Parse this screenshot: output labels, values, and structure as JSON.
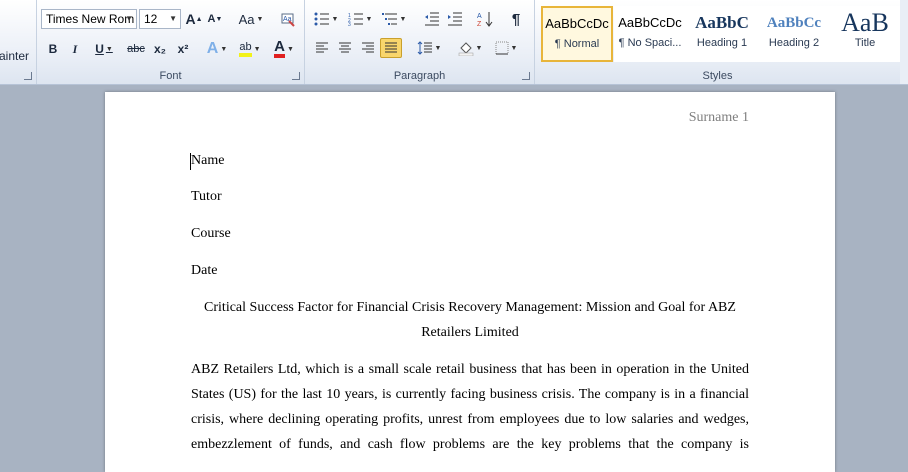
{
  "ribbon": {
    "clipboard": {
      "format_painter_label": "ainter"
    },
    "font": {
      "group_label": "Font",
      "font_name": "Times New Rom",
      "font_size": "12",
      "grow_label": "A",
      "shrink_label": "A",
      "change_case_label": "Aa",
      "bold": "B",
      "italic": "I",
      "underline": "U",
      "strikethrough": "abc",
      "subscript": "x₂",
      "superscript": "x²",
      "text_effects": "A",
      "highlight": "ab",
      "font_color": "A"
    },
    "paragraph": {
      "group_label": "Paragraph",
      "pilcrow": "¶"
    },
    "styles": {
      "group_label": "Styles",
      "items": [
        {
          "preview": "AaBbCcDc",
          "name": "¶ Normal"
        },
        {
          "preview": "AaBbCcDc",
          "name": "¶ No Spaci..."
        },
        {
          "preview": "AaBbC",
          "name": "Heading 1"
        },
        {
          "preview": "AaBbCc",
          "name": "Heading 2"
        },
        {
          "preview": "AaB",
          "name": "Title"
        }
      ]
    }
  },
  "document": {
    "header": "Surname 1",
    "lines": [
      "Name",
      "Tutor",
      "Course",
      "Date"
    ],
    "title": "Critical Success Factor for Financial Crisis Recovery Management: Mission and Goal for ABZ Retailers Limited",
    "paragraph_lines": [
      "ABZ Retailers Ltd, which is a small scale retail business that has been in operation in the United",
      "States (US) for the last 10 years, is currently facing business crisis. The company is in a financial",
      "crisis, where declining operating profits, unrest from employees due to low salaries and wedges,",
      "embezzlement of funds, and cash flow problems are the key problems that the company is"
    ]
  }
}
